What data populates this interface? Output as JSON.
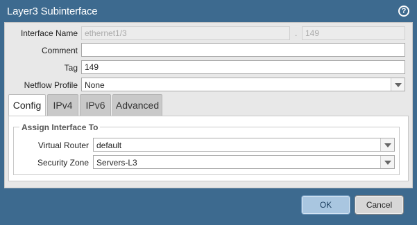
{
  "window": {
    "title": "Layer3 Subinterface",
    "help_icon": "question-mark-icon"
  },
  "form": {
    "interface_name": {
      "label": "Interface Name",
      "value": "ethernet1/3",
      "separator": ".",
      "suffix": "149"
    },
    "comment": {
      "label": "Comment",
      "value": ""
    },
    "tag": {
      "label": "Tag",
      "value": "149"
    },
    "netflow_profile": {
      "label": "Netflow Profile",
      "value": "None"
    }
  },
  "tabs": [
    {
      "label": "Config",
      "active": true
    },
    {
      "label": "IPv4",
      "active": false
    },
    {
      "label": "IPv6",
      "active": false
    },
    {
      "label": "Advanced",
      "active": false
    }
  ],
  "assign": {
    "legend": "Assign Interface To",
    "virtual_router": {
      "label": "Virtual Router",
      "value": "default"
    },
    "security_zone": {
      "label": "Security Zone",
      "value": "Servers-L3"
    }
  },
  "buttons": {
    "ok": "OK",
    "cancel": "Cancel"
  },
  "colors": {
    "titlebar": "#3d6a8f",
    "panel": "#e8e8e8",
    "ok_button": "#a9c6e0"
  }
}
